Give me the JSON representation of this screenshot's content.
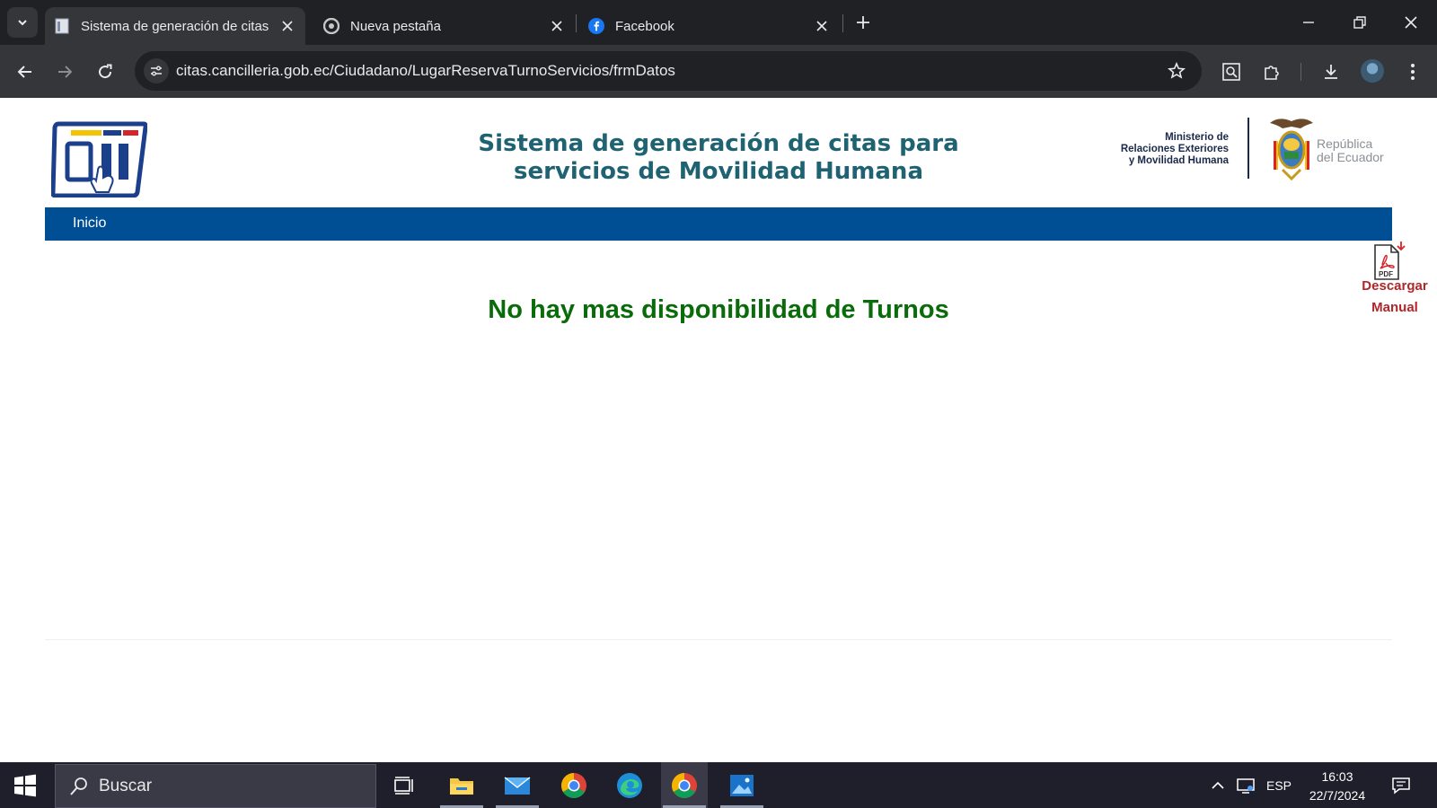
{
  "browser": {
    "tabs": [
      {
        "title": "Sistema de generación de citas",
        "icon": "page-icon",
        "active": true
      },
      {
        "title": "Nueva pestaña",
        "icon": "chrome-icon",
        "active": false
      },
      {
        "title": "Facebook",
        "icon": "facebook-icon",
        "active": false
      }
    ],
    "url": "citas.cancilleria.gob.ec/Ciudadano/LugarReservaTurnoServicios/frmDatos"
  },
  "site": {
    "title_line1": "Sistema de generación de citas para",
    "title_line2": "servicios de Movilidad Humana",
    "ministry_line1": "Ministerio de",
    "ministry_line2": "Relaciones Exteriores",
    "ministry_line3": "y Movilidad Humana",
    "republic_line1": "República",
    "republic_line2": "del Ecuador",
    "nav_inicio": "Inicio",
    "manual_line1": "Descargar",
    "manual_line2": "Manual",
    "pdf_badge": "PDF",
    "message": "No hay mas disponibilidad de Turnos"
  },
  "taskbar": {
    "search_placeholder": "Buscar",
    "language": "ESP",
    "time": "16:03",
    "date": "22/7/2024",
    "apps": [
      "task-view",
      "file-explorer",
      "mail",
      "chrome",
      "edge",
      "chrome-active",
      "photos"
    ]
  },
  "colors": {
    "nav_blue": "#004e93",
    "title_teal": "#1f6373",
    "message_green": "#0a6b0a",
    "manual_red": "#b0262a"
  }
}
